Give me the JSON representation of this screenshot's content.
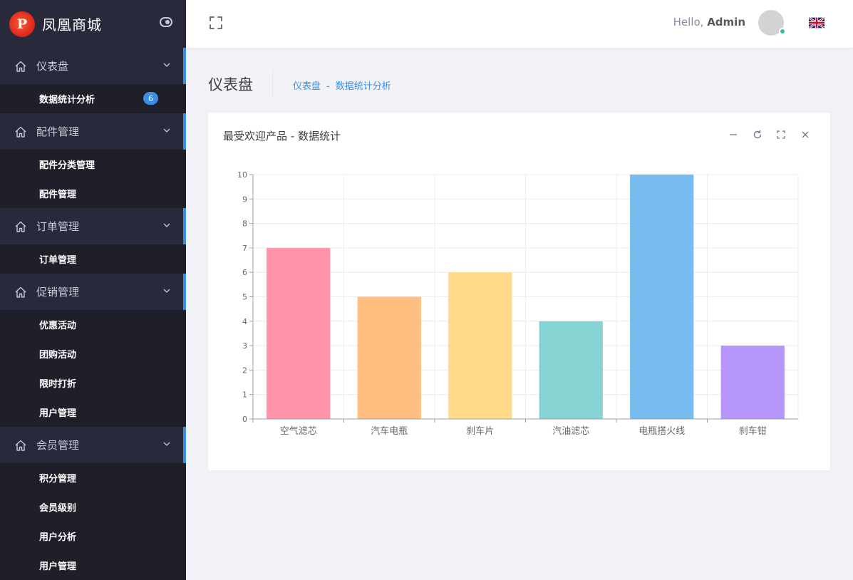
{
  "brand": {
    "name": "凤凰商城",
    "logo_letter": "P"
  },
  "sidebar": {
    "sections": [
      {
        "label": "仪表盘",
        "items": [
          {
            "label": "数据统计分析",
            "badge": "6"
          }
        ]
      },
      {
        "label": "配件管理",
        "items": [
          {
            "label": "配件分类管理"
          },
          {
            "label": "配件管理"
          }
        ]
      },
      {
        "label": "订单管理",
        "items": [
          {
            "label": "订单管理"
          }
        ]
      },
      {
        "label": "促销管理",
        "items": [
          {
            "label": "优惠活动"
          },
          {
            "label": "团购活动"
          },
          {
            "label": "限时打折"
          },
          {
            "label": "用户管理"
          }
        ]
      },
      {
        "label": "会员管理",
        "items": [
          {
            "label": "积分管理"
          },
          {
            "label": "会员级别"
          },
          {
            "label": "用户分析"
          },
          {
            "label": "用户管理"
          }
        ]
      }
    ]
  },
  "header": {
    "greeting": "Hello,",
    "user": "Admin"
  },
  "page": {
    "title": "仪表盘",
    "breadcrumb": [
      "仪表盘",
      "-",
      "数据统计分析"
    ]
  },
  "card": {
    "title": "最受欢迎产品 - 数据统计"
  },
  "colors": {
    "accent": "#3a8ee6",
    "online": "#34bfa3"
  },
  "chart_data": {
    "type": "bar",
    "title": "",
    "categories": [
      "空气滤芯",
      "汽车电瓶",
      "刹车片",
      "汽油滤芯",
      "电瓶搭火线",
      "刹车钳"
    ],
    "values": [
      7,
      5,
      6,
      4,
      10,
      3
    ],
    "colors": [
      "#ff94aa",
      "#ffbf80",
      "#ffdb8a",
      "#86d3d3",
      "#78bcef",
      "#b796fc"
    ],
    "ylim": [
      0,
      10
    ],
    "yticks": [
      0,
      1,
      2,
      3,
      4,
      5,
      6,
      7,
      8,
      9,
      10
    ],
    "grid": true,
    "legend": "none"
  }
}
